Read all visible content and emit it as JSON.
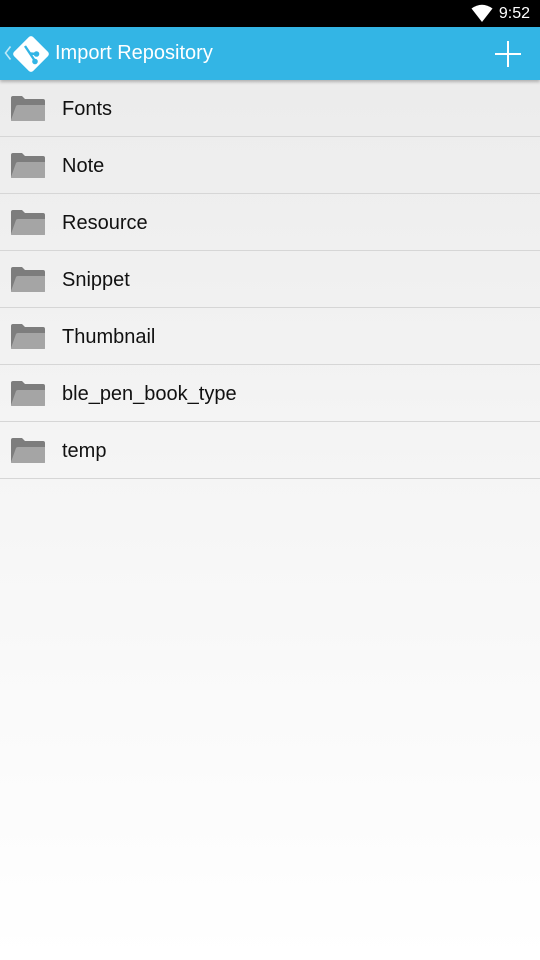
{
  "status_bar": {
    "time": "9:52",
    "wifi_icon": "wifi-icon"
  },
  "action_bar": {
    "title": "Import Repository",
    "logo_icon": "git-logo-icon",
    "add_icon": "plus-icon",
    "accent_color": "#33b5e5"
  },
  "folders": [
    {
      "name": "Fonts"
    },
    {
      "name": "Note"
    },
    {
      "name": "Resource"
    },
    {
      "name": "Snippet"
    },
    {
      "name": "Thumbnail"
    },
    {
      "name": "ble_pen_book_type"
    },
    {
      "name": "temp"
    }
  ]
}
